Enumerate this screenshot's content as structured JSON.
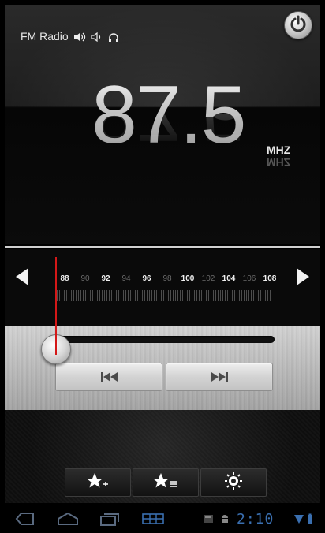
{
  "app": {
    "title": "FM Radio"
  },
  "status_icons": [
    "speaker-icon",
    "speaker-low-icon",
    "headphones-icon"
  ],
  "frequency": {
    "value": "87.5",
    "unit": "MHZ"
  },
  "dial": {
    "labels": [
      {
        "text": "88",
        "major": true
      },
      {
        "text": "90",
        "major": false
      },
      {
        "text": "92",
        "major": true
      },
      {
        "text": "94",
        "major": false
      },
      {
        "text": "96",
        "major": true
      },
      {
        "text": "98",
        "major": false
      },
      {
        "text": "100",
        "major": true
      },
      {
        "text": "102",
        "major": false
      },
      {
        "text": "104",
        "major": true
      },
      {
        "text": "106",
        "major": false
      },
      {
        "text": "108",
        "major": true
      }
    ],
    "current": 87.5,
    "range": [
      87.5,
      108
    ]
  },
  "volume_level": 0.0,
  "toolbar": [
    "favorite-add-icon",
    "favorite-list-icon",
    "settings-icon"
  ],
  "system_bar": {
    "clock": "2:10",
    "icons": [
      "back-icon",
      "home-icon",
      "recent-apps-icon",
      "screenshot-icon",
      "notification-icon",
      "android-icon",
      "wifi-icon",
      "battery-icon"
    ]
  },
  "colors": {
    "needle": "#d41818",
    "clock": "#3a6fb0",
    "accent_line": "#cfcfcf"
  }
}
